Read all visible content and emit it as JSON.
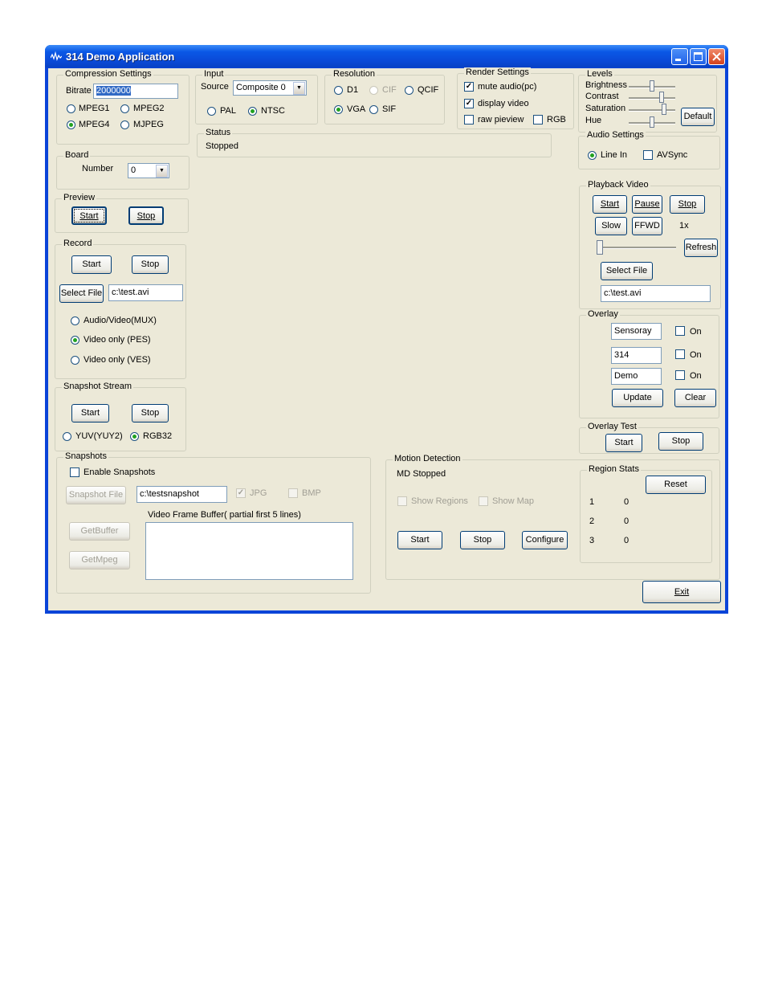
{
  "window": {
    "title": "314 Demo Application"
  },
  "compression": {
    "legend": "Compression Settings",
    "bitrate_label": "Bitrate",
    "bitrate_value": "2000000",
    "options": [
      "MPEG1",
      "MPEG2",
      "MPEG4",
      "MJPEG"
    ],
    "selected": "MPEG4"
  },
  "input": {
    "legend": "Input",
    "source_label": "Source",
    "source_value": "Composite 0",
    "standards": [
      "PAL",
      "NTSC"
    ],
    "selected": "NTSC"
  },
  "resolution": {
    "legend": "Resolution",
    "options": [
      "D1",
      "CIF",
      "QCIF",
      "VGA",
      "SIF"
    ],
    "selected": "VGA"
  },
  "render": {
    "legend": "Render Settings",
    "mute_audio": "mute audio(pc)",
    "display_video": "display video",
    "raw_preview": "raw pieview",
    "rgb": "RGB"
  },
  "levels": {
    "legend": "Levels",
    "brightness": "Brightness",
    "contrast": "Contrast",
    "saturation": "Saturation",
    "hue": "Hue",
    "default_button": "Default"
  },
  "status": {
    "legend": "Status",
    "value": "Stopped"
  },
  "audio": {
    "legend": "Audio Settings",
    "line_in": "Line In",
    "avsync": "AVSync"
  },
  "board": {
    "legend": "Board",
    "number_label": "Number",
    "number_value": "0"
  },
  "preview": {
    "legend": "Preview",
    "start": "Start",
    "stop": "Stop"
  },
  "record": {
    "legend": "Record",
    "start": "Start",
    "stop": "Stop",
    "select_file": "Select File",
    "file_path": "c:\\test.avi",
    "options": [
      "Audio/Video(MUX)",
      "Video only (PES)",
      "Video only (VES)"
    ],
    "selected": "Video only (PES)"
  },
  "playback": {
    "legend": "Playback Video",
    "start": "Start",
    "pause": "Pause",
    "stop": "Stop",
    "slow": "Slow",
    "ffwd": "FFWD",
    "speed": "1x",
    "refresh": "Refresh",
    "select_file": "Select File",
    "file_path": "c:\\test.avi"
  },
  "overlay": {
    "legend": "Overlay",
    "line1": "Sensoray",
    "line2": "314",
    "line3": "Demo",
    "on_label": "On",
    "update": "Update",
    "clear": "Clear"
  },
  "snapshot_stream": {
    "legend": "Snapshot Stream",
    "start": "Start",
    "stop": "Stop",
    "yuv": "YUV(YUY2)",
    "rgb32": "RGB32"
  },
  "overlay_test": {
    "legend": "Overlay Test",
    "start": "Start",
    "stop": "Stop"
  },
  "snapshots": {
    "legend": "Snapshots",
    "enable": "Enable Snapshots",
    "snapshot_file": "Snapshot File",
    "file_path": "c:\\testsnapshot",
    "jpg": "JPG",
    "bmp": "BMP",
    "buffer_label": "Video Frame Buffer( partial first 5 lines)",
    "get_buffer": "GetBuffer",
    "get_mpeg": "GetMpeg"
  },
  "motion": {
    "legend": "Motion Detection",
    "status": "MD Stopped",
    "show_regions": "Show Regions",
    "show_map": "Show Map",
    "start": "Start",
    "stop": "Stop",
    "configure": "Configure"
  },
  "region_stats": {
    "legend": "Region Stats",
    "reset": "Reset",
    "rows": [
      {
        "id": "1",
        "value": "0"
      },
      {
        "id": "2",
        "value": "0"
      },
      {
        "id": "3",
        "value": "0"
      }
    ]
  },
  "exit_button": "Exit"
}
